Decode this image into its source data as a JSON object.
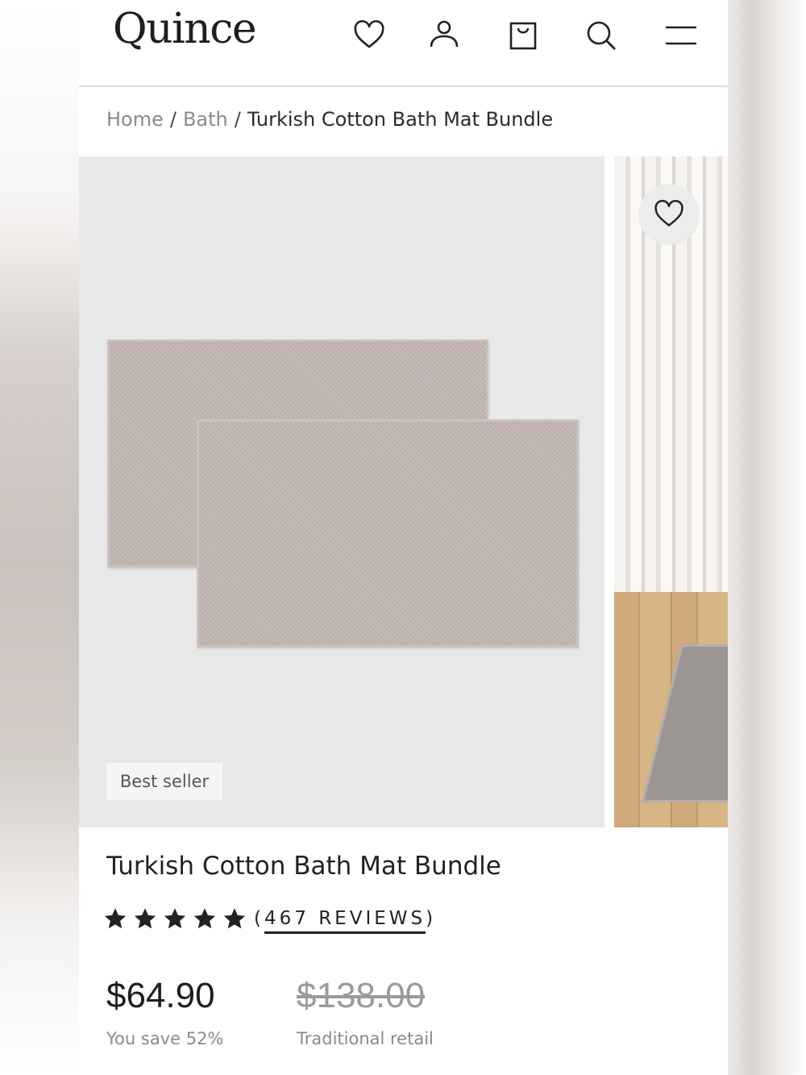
{
  "header": {
    "logo": "Quince",
    "icons": [
      "heart-icon",
      "account-icon",
      "bag-icon",
      "search-icon",
      "menu-icon"
    ]
  },
  "breadcrumb": {
    "home": "Home",
    "separator": "/",
    "category": "Bath",
    "current": "Turkish Cotton Bath Mat Bundle"
  },
  "gallery": {
    "badge": "Best seller",
    "favorite_icon": "heart-icon"
  },
  "product": {
    "title": "Turkish Cotton Bath Mat Bundle",
    "rating": 5,
    "reviews_open": "(",
    "reviews_label": "467 REVIEWS",
    "reviews_close": ")",
    "price": "$64.90",
    "savings": "You save 52%",
    "original_price": "$138.00",
    "original_label": "Traditional retail"
  },
  "colors": {
    "text": "#222222",
    "muted": "#8a8a8a",
    "image_bg": "#e8e8e8",
    "mat": "#c2b6b2"
  }
}
